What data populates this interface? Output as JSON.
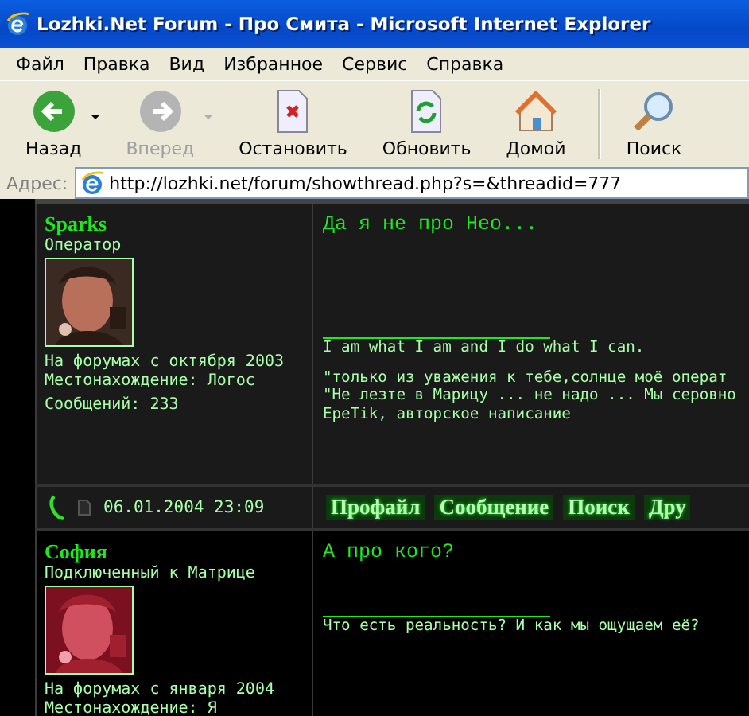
{
  "window": {
    "title": "Lozhki.Net Forum - Про Смита - Microsoft Internet Explorer"
  },
  "menu": [
    "Файл",
    "Правка",
    "Вид",
    "Избранное",
    "Сервис",
    "Справка"
  ],
  "toolbar": [
    {
      "label": "Назад",
      "kind": "back",
      "disabled": false,
      "dropdown": true
    },
    {
      "label": "Вперед",
      "kind": "forward",
      "disabled": true,
      "dropdown": true
    },
    {
      "label": "Остановить",
      "kind": "stop",
      "disabled": false,
      "dropdown": false
    },
    {
      "label": "Обновить",
      "kind": "refresh",
      "disabled": false,
      "dropdown": false
    },
    {
      "label": "Домой",
      "kind": "home",
      "disabled": false,
      "dropdown": false
    },
    {
      "label": "Поиск",
      "kind": "search",
      "disabled": false,
      "dropdown": false
    }
  ],
  "address": {
    "label": "Адрес:",
    "value": "http://lozhki.net/forum/showthread.php?s=&threadid=777"
  },
  "posts": [
    {
      "author": "Sparks",
      "rank": "Оператор",
      "avatar": {
        "kind": "picture"
      },
      "info": [
        "На форумах с октября 2003",
        "Местонахождение: Логос",
        "Сообщений: 233"
      ],
      "title": "Да я не про Нео...",
      "signature": [
        [
          "I am what I am and I do what I can."
        ],
        [
          "\"только из уважения к тебе,солнце моё операт",
          "\"Не лезте в Марицу ... не надо ... Мы серовно",
          "EpeTik, авторское написание"
        ]
      ],
      "footer": {
        "date": "06.01.2004 23:09",
        "buttons": [
          "Профайл",
          "Сообщение",
          "Поиск",
          "Дру"
        ]
      }
    },
    {
      "author": "София",
      "rank": "Подключенный к Матрице",
      "avatar": {
        "kind": "picture"
      },
      "info": [
        "На форумах с января 2004",
        "Местонахождение: Я"
      ],
      "title": "А про кого?",
      "signature": [
        [
          "Что есть реальность? И как мы ощущаем её?"
        ]
      ]
    }
  ]
}
